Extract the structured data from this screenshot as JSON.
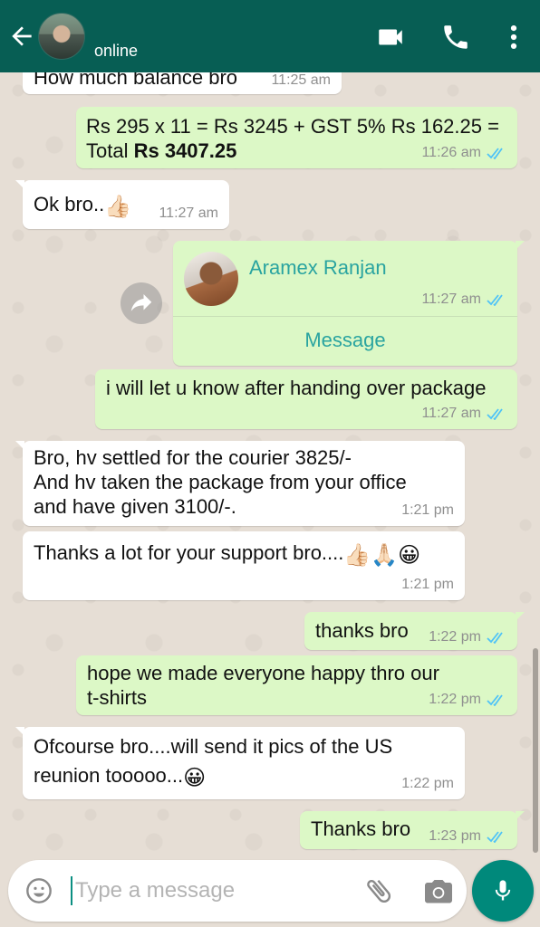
{
  "header": {
    "status": "online"
  },
  "messages": [
    {
      "text": "How much balance bro",
      "time": "11:25 am"
    },
    {
      "text_part1": "Rs 295 x 11 = Rs 3245 + GST 5% Rs 162.25 =",
      "text_part2_plain": "Total ",
      "text_part2_bold": "Rs 3407.25",
      "time": "11:26 am"
    },
    {
      "text": "Ok bro..",
      "emoji": "👍🏻",
      "time": "11:27 am"
    },
    {
      "contact_name": "Aramex Ranjan",
      "time": "11:27 am",
      "action": "Message"
    },
    {
      "text": "i will let u know after handing over package",
      "time": "11:27 am"
    },
    {
      "line1": "Bro, hv settled for the courier 3825/-",
      "line2": "And hv taken the package from your office",
      "line3": "and have given 3100/-.",
      "time": "1:21 pm"
    },
    {
      "text": "Thanks a lot for your support bro....",
      "emoji": "👍🏻🙏🏻😀",
      "time": "1:21 pm"
    },
    {
      "text": "thanks bro",
      "time": "1:22 pm"
    },
    {
      "line1": "hope we made everyone happy thro our",
      "line2": "t-shirts",
      "time": "1:22 pm"
    },
    {
      "line1": "Ofcourse bro....will send it pics of the US",
      "line2": "reunion tooooo...",
      "emoji": "😀",
      "time": "1:22 pm"
    },
    {
      "text": "Thanks bro",
      "time": "1:23 pm"
    }
  ],
  "input": {
    "placeholder": "Type a message"
  },
  "colors": {
    "header": "#075e54",
    "outgoing_bubble": "#dcf8c6",
    "incoming_bubble": "#ffffff",
    "read_ticks": "#4fc3f7",
    "accent": "#00897b"
  },
  "icons": [
    "back-arrow-icon",
    "video-call-icon",
    "phone-icon",
    "more-vert-icon",
    "forward-icon",
    "emoji-icon",
    "attach-icon",
    "camera-icon",
    "mic-icon",
    "double-tick-icon"
  ]
}
